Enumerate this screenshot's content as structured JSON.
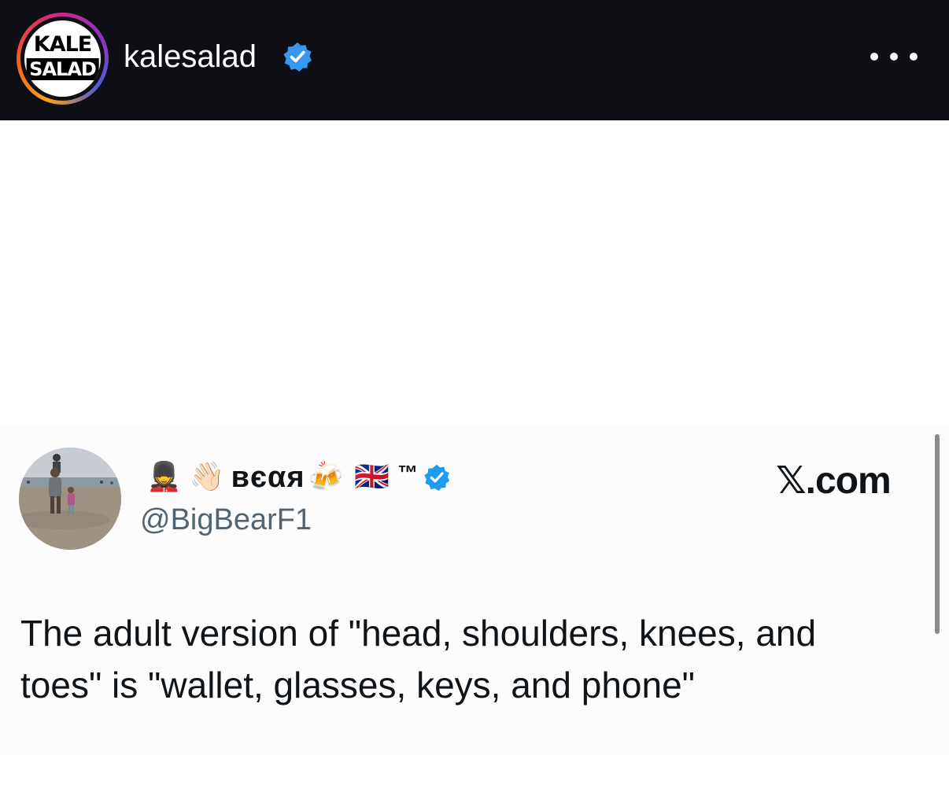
{
  "header": {
    "avatar_logo_top": "KALE",
    "avatar_logo_bottom": "SALAD",
    "username": "kalesalad",
    "verified": true,
    "more_icon": "more-horizontal-icon"
  },
  "tweet": {
    "display_name_prefix_emojis": [
      "💂",
      "👋🏻"
    ],
    "display_name": "вєαя",
    "display_name_suffix_emojis": [
      "🍻",
      "🇬🇧"
    ],
    "tm": "™",
    "handle": "@BigBearF1",
    "source": "𝕏.com",
    "text": "The adult version of \"head, shoulders, knees, and toes\" is \"wallet, glasses, keys, and phone\"",
    "verified": true
  },
  "colors": {
    "header_bg": "#0d0f14",
    "verified_blue": "#1d9bf0",
    "text_primary": "#0f1419",
    "text_secondary": "#536471"
  }
}
